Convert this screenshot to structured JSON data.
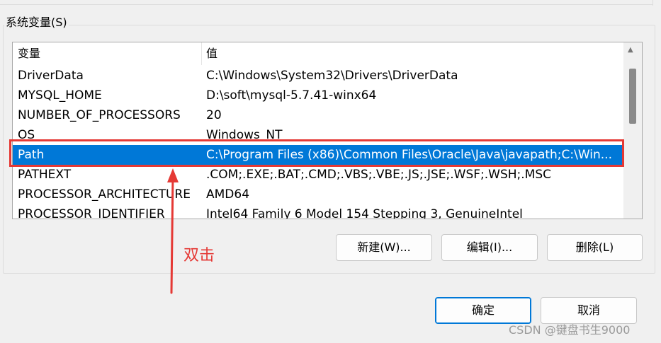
{
  "system_vars": {
    "group_title": "系统变量(S)",
    "columns": {
      "name": "变量",
      "value": "值"
    },
    "rows": [
      {
        "name": "DriverData",
        "value": "C:\\Windows\\System32\\Drivers\\DriverData"
      },
      {
        "name": "MYSQL_HOME",
        "value": "D:\\soft\\mysql-5.7.41-winx64"
      },
      {
        "name": "NUMBER_OF_PROCESSORS",
        "value": "20"
      },
      {
        "name": "OS",
        "value": "Windows_NT"
      },
      {
        "name": "Path",
        "value": "C:\\Program Files (x86)\\Common Files\\Oracle\\Java\\javapath;C:\\Win..."
      },
      {
        "name": "PATHEXT",
        "value": ".COM;.EXE;.BAT;.CMD;.VBS;.VBE;.JS;.JSE;.WSF;.WSH;.MSC"
      },
      {
        "name": "PROCESSOR_ARCHITECTURE",
        "value": "AMD64"
      },
      {
        "name": "PROCESSOR_IDENTIFIER",
        "value": "Intel64 Family 6 Model 154 Stepping 3, GenuineIntel"
      }
    ],
    "selected_row": "Path"
  },
  "buttons": {
    "new": "新建(W)...",
    "edit": "编辑(I)...",
    "delete": "删除(L)",
    "ok": "确定",
    "cancel": "取消"
  },
  "annotation": {
    "text": "双击",
    "color": "#e53935"
  },
  "colors": {
    "selection": "#0078d7",
    "highlight_border": "#e53935"
  },
  "watermark": "CSDN @键盘书生9000"
}
